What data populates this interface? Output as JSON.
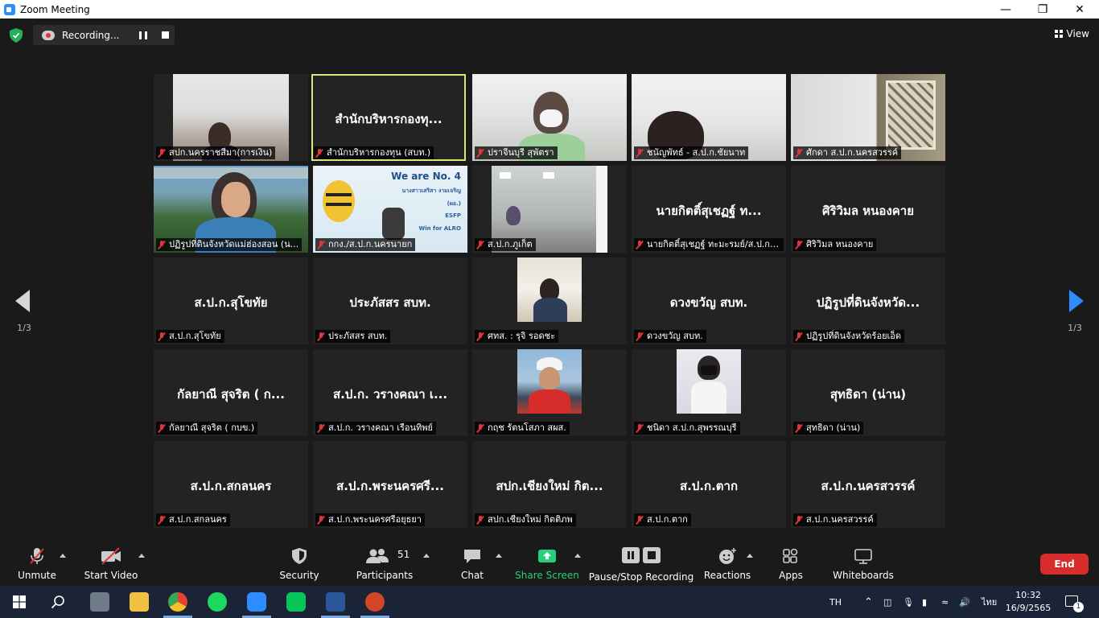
{
  "window": {
    "title": "Zoom Meeting"
  },
  "topbar": {
    "recording_label": "Recording...",
    "view_label": "View"
  },
  "pagination": {
    "left_page": "1/3",
    "right_page": "1/3"
  },
  "tiles": [
    {
      "big_name": "",
      "nameplate": "สปก.นครราชสีมา(การเงิน)",
      "video": true
    },
    {
      "big_name": "สำนักบริหารกองทุ...",
      "nameplate": "สำนักบริหารกองทุน (สบท.)",
      "video": false,
      "active": true
    },
    {
      "big_name": "",
      "nameplate": "ปราจีนบุรี สุพัตรา",
      "video": true
    },
    {
      "big_name": "",
      "nameplate": "ชนัญพัทธ์ - ส.ป.ก.ชัยนาท",
      "video": true
    },
    {
      "big_name": "",
      "nameplate": "ศักดา ส.ป.ก.นครสวรรค์",
      "video": true
    },
    {
      "big_name": "",
      "nameplate": "ปฏิรูปที่ดินจังหวัดแม่ฮ่องสอน (น...",
      "video": true
    },
    {
      "big_name": "",
      "nameplate": "กกง./ส.ป.ก.นครนายก",
      "video": true
    },
    {
      "big_name": "",
      "nameplate": "ส.ป.ก.ภูเก็ต",
      "video": true
    },
    {
      "big_name": "นายกิตติ์สุเชฏฐ์ ท...",
      "nameplate": "นายกิตติ์สุเชฏฐ์ ทะมะรมย์/ส.ป.ก....",
      "video": false
    },
    {
      "big_name": "ศิริวิมล หนองคาย",
      "nameplate": "ศิริวิมล หนองคาย",
      "video": false
    },
    {
      "big_name": "ส.ป.ก.สุโขทัย",
      "nameplate": "ส.ป.ก.สุโขทัย",
      "video": false
    },
    {
      "big_name": "ประภัสสร สบท.",
      "nameplate": "ประภัสสร สบท.",
      "video": false
    },
    {
      "big_name": "",
      "nameplate": "ศทส. : รุจิ รอดชะ",
      "video": false,
      "thumb": true
    },
    {
      "big_name": "ดวงขวัญ สบท.",
      "nameplate": "ดวงขวัญ สบท.",
      "video": false
    },
    {
      "big_name": "ปฏิรูปที่ดินจังหวัด...",
      "nameplate": "ปฏิรูปที่ดินจังหวัดร้อยเอ็ด",
      "video": false
    },
    {
      "big_name": "กัลยาณี สุจริต ( ก...",
      "nameplate": "กัลยาณี สุจริต ( กบข.)",
      "video": false
    },
    {
      "big_name": "ส.ป.ก. วรางคณา เ...",
      "nameplate": "ส.ป.ก. วรางคณา เรือนทิพย์",
      "video": false
    },
    {
      "big_name": "",
      "nameplate": "กฤช รัตนโสภา สผส.",
      "video": false,
      "thumb": true
    },
    {
      "big_name": "",
      "nameplate": "ชนิดา ส.ป.ก.สุพรรณบุรี",
      "video": false,
      "thumb": true
    },
    {
      "big_name": "สุทธิดา (น่าน)",
      "nameplate": "สุทธิดา (น่าน)",
      "video": false
    },
    {
      "big_name": "ส.ป.ก.สกลนคร",
      "nameplate": "ส.ป.ก.สกลนคร",
      "video": false
    },
    {
      "big_name": "ส.ป.ก.พระนครศรี...",
      "nameplate": "ส.ป.ก.พระนครศรีอยุธยา",
      "video": false
    },
    {
      "big_name": "สปก.เชียงใหม่ กิต...",
      "nameplate": "สปก.เชียงใหม่ กิตติภพ",
      "video": false
    },
    {
      "big_name": "ส.ป.ก.ตาก",
      "nameplate": "ส.ป.ก.ตาก",
      "video": false
    },
    {
      "big_name": "ส.ป.ก.นครสวรรค์",
      "nameplate": "ส.ป.ก.นครสวรรค์",
      "video": false
    }
  ],
  "slide": {
    "headline": "We are No. 4",
    "lines": [
      "นางสาวเสริสา งามเจริญ",
      "(ผอ.)",
      "ESFP",
      "Win for ALRO"
    ]
  },
  "toolbar": {
    "unmute": "Unmute",
    "start_video": "Start Video",
    "security": "Security",
    "participants": "Participants",
    "participants_count": "51",
    "chat": "Chat",
    "share_screen": "Share Screen",
    "pause_stop_recording": "Pause/Stop Recording",
    "reactions": "Reactions",
    "apps": "Apps",
    "whiteboards": "Whiteboards",
    "end": "End"
  },
  "taskbar": {
    "language": "TH",
    "ime": "ไทย",
    "time": "10:32",
    "date": "16/9/2565",
    "notification_count": "1"
  },
  "colors": {
    "accent": "#2d8cff",
    "share_green": "#26d07c",
    "end_red": "#d92d2d",
    "muted_red": "#e0353b",
    "active_speaker": "#d8e67a"
  }
}
